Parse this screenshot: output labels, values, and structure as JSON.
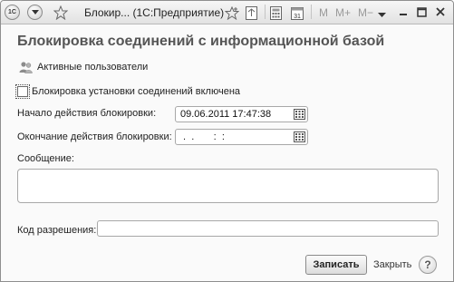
{
  "window": {
    "app_badge": "1С",
    "title": "Блокир...  (1С:Предприятие)",
    "toolbar_items": [
      "M",
      "M+",
      "M−"
    ],
    "close_symbol": "✕",
    "minimize_symbol": "—",
    "maximize_symbol": "☐"
  },
  "form": {
    "heading": "Блокировка соединений с информационной базой",
    "active_users_link": "Активные пользователи",
    "lock_checkbox_label": "Блокировка установки соединений включена",
    "lock_enabled": false,
    "start_label": "Начало действия блокировки:",
    "start_value": "09.06.2011 17:47:38",
    "end_label": "Окончание действия блокировки:",
    "end_value": " .  .       :  :",
    "message_label": "Сообщение:",
    "message_value": "",
    "permission_code_label": "Код разрешения:",
    "permission_code_value": ""
  },
  "actions": {
    "save_label": "Записать",
    "close_label": "Закрыть",
    "help_label": "?"
  },
  "icons": {
    "app": "1c-logo-icon",
    "menu": "chevron-down-icon",
    "favorite": "star-icon",
    "calendar": "calendar-icon",
    "users": "users-icon"
  }
}
